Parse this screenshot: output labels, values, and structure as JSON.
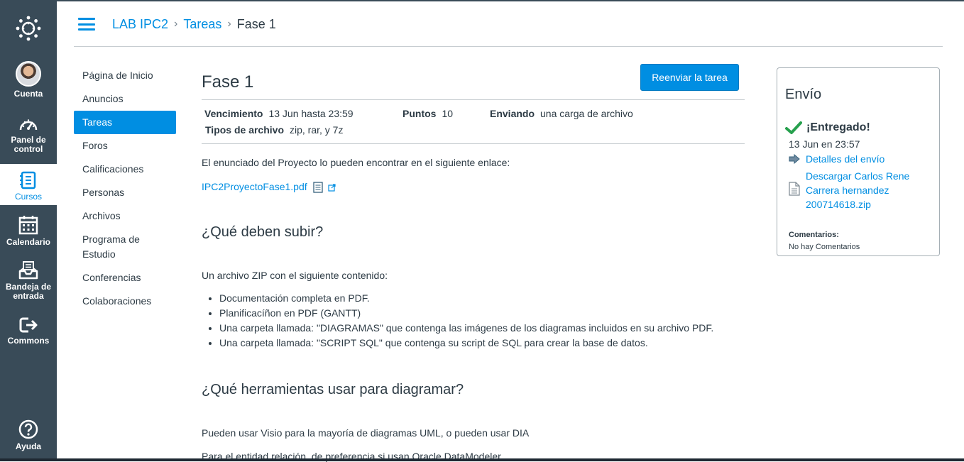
{
  "global_nav": {
    "items": [
      {
        "id": "logo",
        "label": ""
      },
      {
        "id": "account",
        "label": "Cuenta"
      },
      {
        "id": "dashboard",
        "label": "Panel de control"
      },
      {
        "id": "courses",
        "label": "Cursos"
      },
      {
        "id": "calendar",
        "label": "Calendario"
      },
      {
        "id": "inbox",
        "label": "Bandeja de entrada"
      },
      {
        "id": "commons",
        "label": "Commons"
      },
      {
        "id": "help",
        "label": "Ayuda"
      }
    ],
    "active": "courses"
  },
  "breadcrumb": {
    "course": "LAB IPC2",
    "section": "Tareas",
    "current": "Fase 1",
    "separator": "›"
  },
  "course_nav": {
    "items": [
      "Página de Inicio",
      "Anuncios",
      "Tareas",
      "Foros",
      "Calificaciones",
      "Personas",
      "Archivos",
      "Programa de Estudio",
      "Conferencias",
      "Colaboraciones"
    ],
    "active": "Tareas"
  },
  "assignment": {
    "title": "Fase 1",
    "resubmit_label": "Reenviar la tarea",
    "due_label": "Vencimiento",
    "due_value": "13 Jun hasta 23:59",
    "points_label": "Puntos",
    "points_value": "10",
    "submitting_label": "Enviando",
    "submitting_value": "una carga de archivo",
    "filetypes_label": "Tipos de archivo",
    "filetypes_value": "zip, rar, y 7z"
  },
  "description": {
    "intro": "El enunciado del Proyecto lo pueden encontrar en el siguiente enlace:",
    "file_link": "IPC2ProyectoFase1.pdf",
    "h1": "¿Qué deben subir?",
    "p1": "Un archivo ZIP con el siguiente contenido:",
    "list": [
      "Documentación completa en PDF.",
      "Planificacíñon en PDF (GANTT)",
      "Una carpeta llamada: \"DIAGRAMAS\" que contenga las imágenes de los diagramas incluidos en su archivo PDF.",
      "Una carpeta llamada: \"SCRIPT SQL\" que contenga su script de SQL para crear la base de datos."
    ],
    "h2": "¿Qué herramientas usar para diagramar?",
    "p2": "Pueden usar Visio para la mayoría de diagramas UML, o pueden usar DIA",
    "p3": "Para el entidad relación, de preferencia si usan Oracle DataModeler"
  },
  "submission": {
    "title": "Envío",
    "status": "¡Entregado!",
    "date": "13 Jun en 23:57",
    "details_link": "Detalles del envío",
    "download_link": "Descargar Carlos Rene Carrera hernandez 200714618.zip",
    "comments_label": "Comentarios:",
    "comments_value": "No hay Comentarios"
  },
  "colors": {
    "nav_bg": "#394b58",
    "accent": "#008ee2",
    "success": "#26a04d"
  }
}
